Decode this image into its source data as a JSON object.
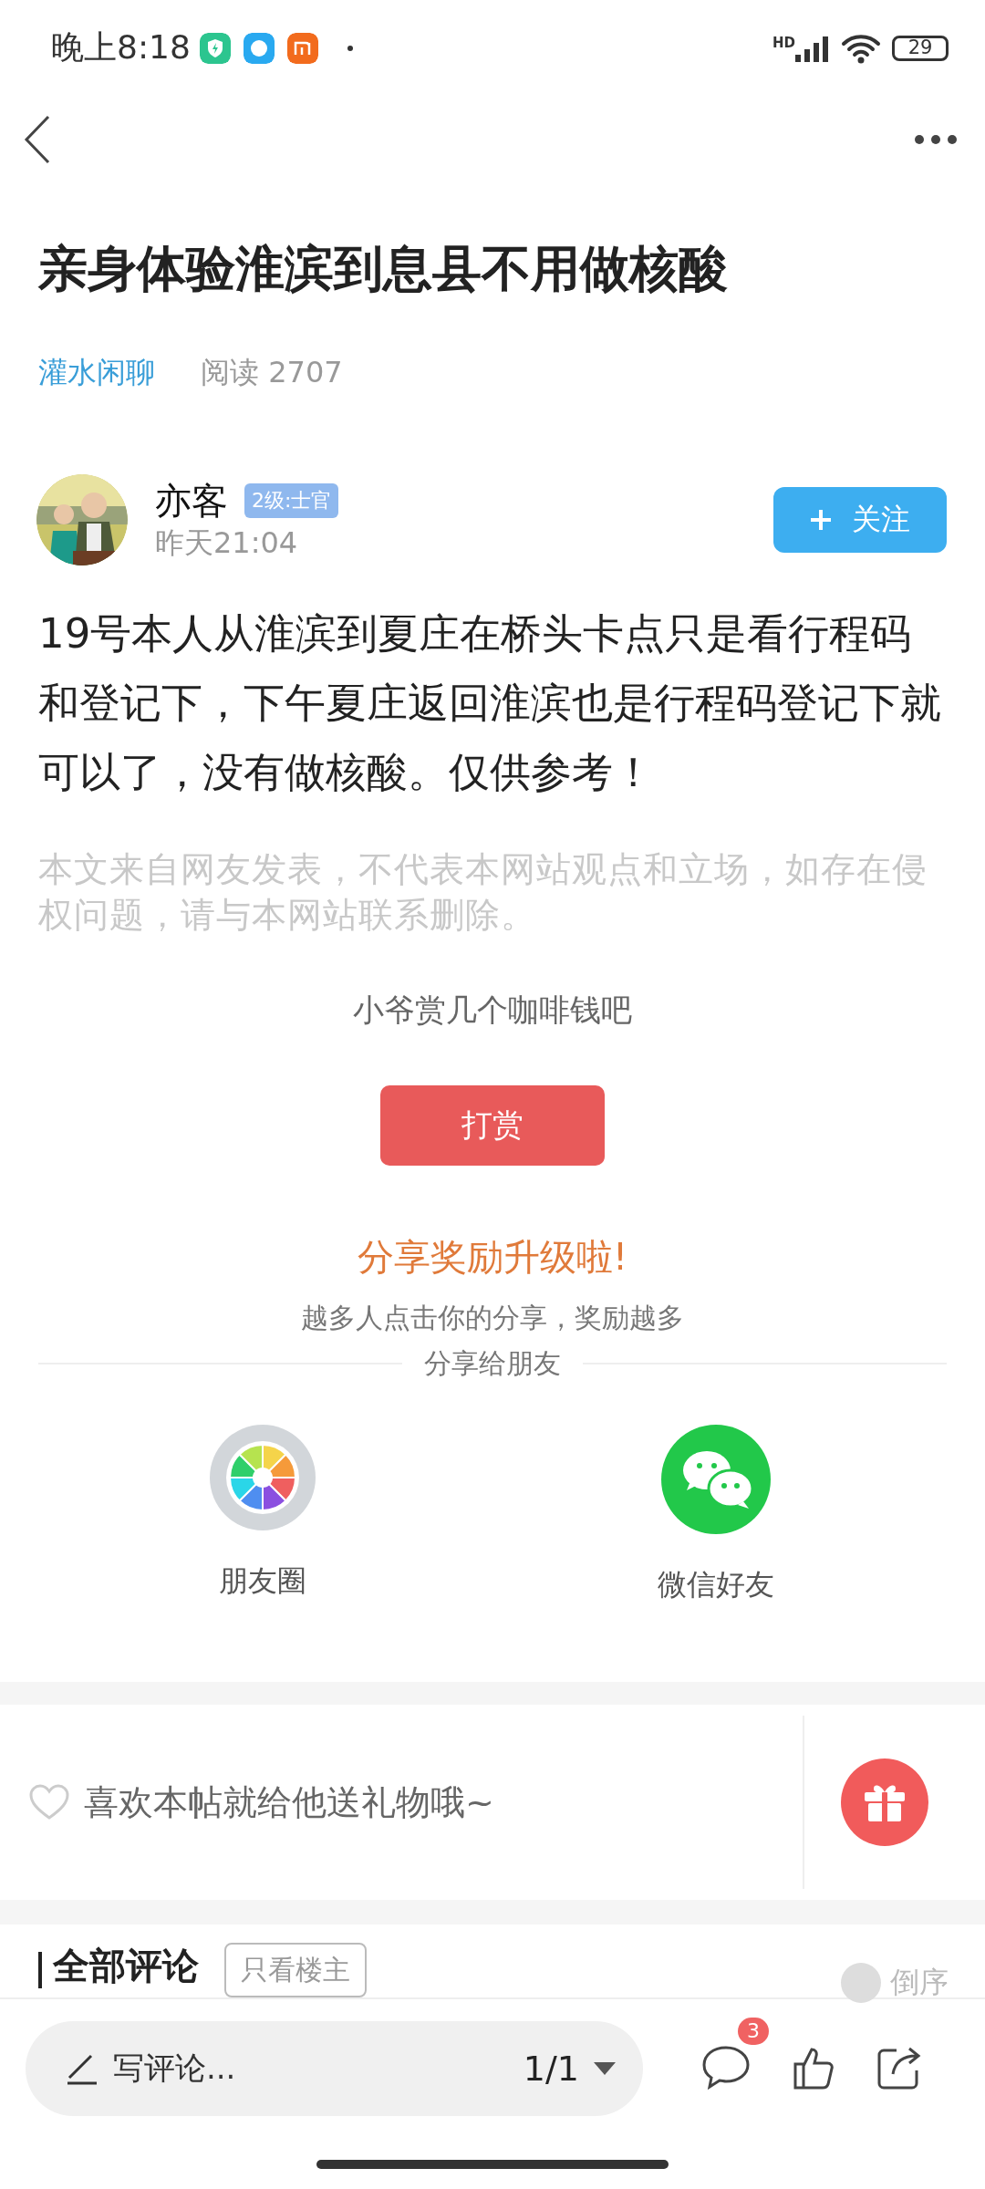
{
  "status_bar": {
    "time": "晚上8:18",
    "network": "HD",
    "battery": "29"
  },
  "post": {
    "title": "亲身体验淮滨到息县不用做核酸",
    "category": "灌水闲聊",
    "reads": "阅读 2707"
  },
  "author": {
    "name": "亦客",
    "rank": "2级:士官",
    "time": "昨天21:04",
    "follow": "关注"
  },
  "body": "19号本人从淮滨到夏庄在桥头卡点只是看行程码和登记下，下午夏庄返回淮滨也是行程码登记下就可以了，没有做核酸。仅供参考！",
  "disclaimer": "本文来自网友发表，不代表本网站观点和立场，如存在侵权问题，请与本网站联系删除。",
  "tip": {
    "prompt": "小爷赏几个咖啡钱吧",
    "button": "打赏"
  },
  "share": {
    "headline": "分享奖励升级啦!",
    "subline": "越多人点击你的分享，奖励越多",
    "divider_label": "分享给朋友",
    "targets": [
      {
        "kind": "moments",
        "label": "朋友圈"
      },
      {
        "kind": "wechat",
        "label": "微信好友"
      }
    ]
  },
  "gift": {
    "prompt": "喜欢本帖就给他送礼物哦~"
  },
  "comments": {
    "title": "全部评论",
    "filter": "只看楼主",
    "sort": "倒序"
  },
  "bottom_bar": {
    "placeholder": "写评论...",
    "page": "1/1",
    "comment_count": "3"
  }
}
